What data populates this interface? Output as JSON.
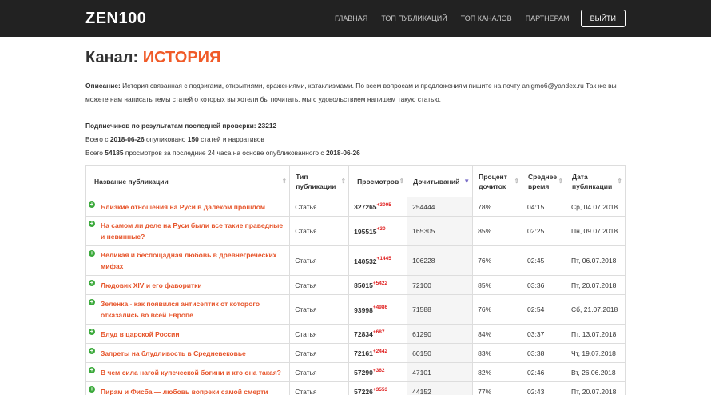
{
  "header": {
    "logo": "ZEN100",
    "nav": [
      "ГЛАВНАЯ",
      "ТОП ПУБЛИКАЦИЙ",
      "ТОП КАНАЛОВ",
      "ПАРТНЕРАМ"
    ],
    "logout_label": "ВЫЙТИ"
  },
  "channel": {
    "title_prefix": "Канал:",
    "title_name": "ИСТОРИЯ",
    "desc_label": "Описание:",
    "desc_text": "История связанная с подвигами, открытиями, сражениями, катаклизмами. По всем вопросам и предложениям пишите на почту anigmo6@yandex.ru Так же вы можете нам написать темы статей о которых вы хотели бы почитать, мы с удовольствием напишем такую статью.",
    "subs_label": "Подписчиков по результатам последней проверки:",
    "subs_value": "23212",
    "line2_a": "Всего с ",
    "line2_date": "2018-06-26",
    "line2_b": " опуликовано ",
    "line2_count": "150",
    "line2_c": " статей и нарративов",
    "line3_a": "Всего ",
    "line3_views": "54185",
    "line3_b": " просмотров за последние 24 часа на основе опубликованного с ",
    "line3_date": "2018-06-26"
  },
  "table": {
    "columns": [
      "Название публикации",
      "Тип публикации",
      "Просмотров",
      "Дочитываний",
      "Процент дочиток",
      "Среднее время",
      "Дата публикации"
    ],
    "rows": [
      {
        "title": "Близкие отношения на Руси в далеком прошлом",
        "type": "Статья",
        "views": "327265",
        "delta": "+3005",
        "reads": "254444",
        "pct": "78%",
        "time": "04:15",
        "date": "Ср, 04.07.2018"
      },
      {
        "title": "На самом ли деле на Руси были все такие праведные и невинные?",
        "type": "Статья",
        "views": "195515",
        "delta": "+30",
        "reads": "165305",
        "pct": "85%",
        "time": "02:25",
        "date": "Пн, 09.07.2018"
      },
      {
        "title": "Великая и беспощадная любовь в древнегреческих мифах",
        "type": "Статья",
        "views": "140532",
        "delta": "+1445",
        "reads": "106228",
        "pct": "76%",
        "time": "02:45",
        "date": "Пт, 06.07.2018"
      },
      {
        "title": "Людовик XIV и его фаворитки",
        "type": "Статья",
        "views": "85015",
        "delta": "+5422",
        "reads": "72100",
        "pct": "85%",
        "time": "03:36",
        "date": "Пт, 20.07.2018"
      },
      {
        "title": "Зеленка - как появился антисептик от которого отказались во всей Европе",
        "type": "Статья",
        "views": "93998",
        "delta": "+4986",
        "reads": "71588",
        "pct": "76%",
        "time": "02:54",
        "date": "Сб, 21.07.2018"
      },
      {
        "title": "Блуд в царской России",
        "type": "Статья",
        "views": "72834",
        "delta": "+687",
        "reads": "61290",
        "pct": "84%",
        "time": "03:37",
        "date": "Пт, 13.07.2018"
      },
      {
        "title": "Запреты на блудливость в Средневековье",
        "type": "Статья",
        "views": "72161",
        "delta": "+2442",
        "reads": "60150",
        "pct": "83%",
        "time": "03:38",
        "date": "Чт, 19.07.2018"
      },
      {
        "title": "В чем сила нагой купеческой богини и кто она такая?",
        "type": "Статья",
        "views": "57290",
        "delta": "+362",
        "reads": "47101",
        "pct": "82%",
        "time": "02:46",
        "date": "Вт, 26.06.2018"
      },
      {
        "title": "Пирам и Фисба — любовь вопреки самой смерти",
        "type": "Статья",
        "views": "57226",
        "delta": "+3553",
        "reads": "44152",
        "pct": "77%",
        "time": "02:43",
        "date": "Пт, 20.07.2018"
      }
    ]
  }
}
